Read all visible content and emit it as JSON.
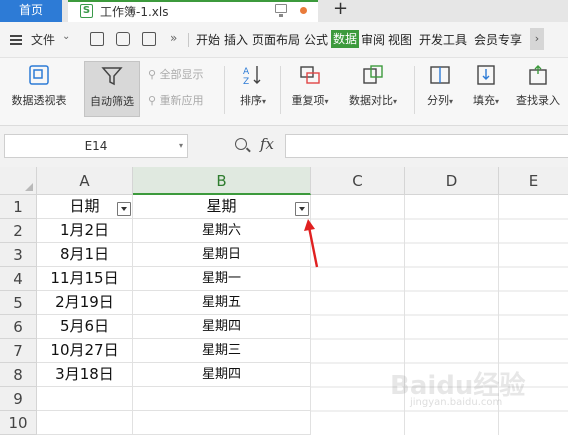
{
  "tabs": {
    "home": "首页",
    "document": "工作簿-1.xls",
    "add": "+"
  },
  "menu": {
    "file": "文件",
    "more": "»",
    "items": [
      "开始",
      "插入",
      "页面布局",
      "公式",
      "数据",
      "审阅",
      "视图",
      "开发工具",
      "会员专享"
    ],
    "active": "数据",
    "scroll": "›"
  },
  "ribbon": {
    "pivot": "数据透视表",
    "autofilter": "自动筛选",
    "show_all": "全部显示",
    "reapply": "重新应用",
    "sort": "排序",
    "duplicates": "重复项",
    "compare": "数据对比",
    "split": "分列",
    "fill": "填充",
    "lookup": "查找录入"
  },
  "formula_bar": {
    "name_box": "E14",
    "fx": "fx",
    "content": ""
  },
  "sheet": {
    "columns": [
      "A",
      "B",
      "C",
      "D",
      "E"
    ],
    "selected_column": "B",
    "rows": [
      "1",
      "2",
      "3",
      "4",
      "5",
      "6",
      "7",
      "8",
      "9",
      "10"
    ],
    "headers": {
      "a": "日期",
      "b": "星期"
    },
    "data": [
      {
        "a": "1月2日",
        "b": "星期六"
      },
      {
        "a": "8月1日",
        "b": "星期日"
      },
      {
        "a": "11月15日",
        "b": "星期一"
      },
      {
        "a": "2月19日",
        "b": "星期五"
      },
      {
        "a": "5月6日",
        "b": "星期四"
      },
      {
        "a": "10月27日",
        "b": "星期三"
      },
      {
        "a": "3月18日",
        "b": "星期四"
      }
    ]
  },
  "annotation": {
    "arrow_color": "#e02020"
  },
  "watermark": {
    "text": "Baidu经验",
    "sub": "jingyan.baidu.com"
  },
  "colors": {
    "accent_green": "#3c9a3c",
    "home_tab": "#2d7bd6"
  }
}
